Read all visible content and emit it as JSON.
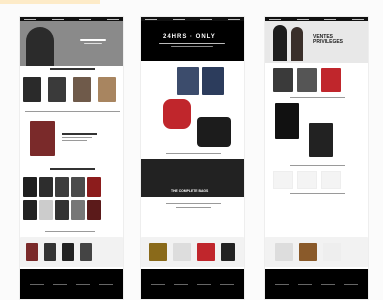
{
  "col1": {
    "hero_title": "",
    "hero_sub": "",
    "section_a": "",
    "section_b": "",
    "footer_logo": ""
  },
  "col2": {
    "hero_title": "24HRS · ONLY",
    "hero_sub": "",
    "promo_title": "THE COMPLETE BAGS",
    "footer_logo": ""
  },
  "col3": {
    "hero_title": "VENTES PRIVILEGES",
    "hero_sub": "",
    "footer_logo": ""
  },
  "colors": {
    "black": "#111111",
    "accent": "#fdebc8",
    "red": "#c0262c"
  }
}
